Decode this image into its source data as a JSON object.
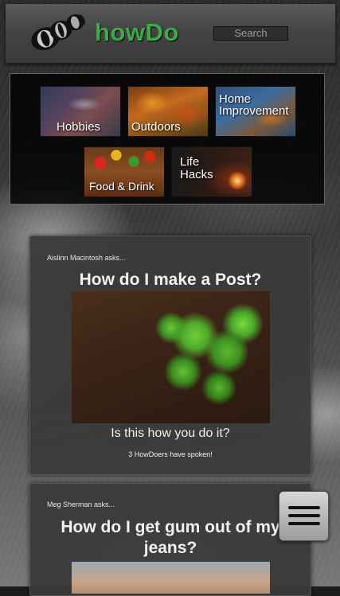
{
  "header": {
    "brand": "howDo",
    "search_placeholder": "Search",
    "logo_icon": "raccoon-tail-logo-icon"
  },
  "categories": [
    {
      "label": "Hobbies"
    },
    {
      "label": "Outdoors"
    },
    {
      "label_line1": "Home",
      "label_line2": "Improvement"
    },
    {
      "label": "Food & Drink"
    },
    {
      "label_line1": "Life",
      "label_line2": "Hacks"
    }
  ],
  "posts": [
    {
      "asker": "Aislinn Macintosh asks...",
      "title": "How do I make a Post?",
      "answer": "Is this how you do it?",
      "responses": "3 HowDoers have spoken!"
    },
    {
      "asker": "Meg Sherman asks...",
      "title": "How do I get gum out of my jeans?"
    }
  ],
  "menu": {
    "icon": "hamburger-menu-icon"
  },
  "colors": {
    "brand_green": "#3fa84a",
    "header_bg": "#4a4a4a",
    "card_bg": "#3a3a3a"
  }
}
